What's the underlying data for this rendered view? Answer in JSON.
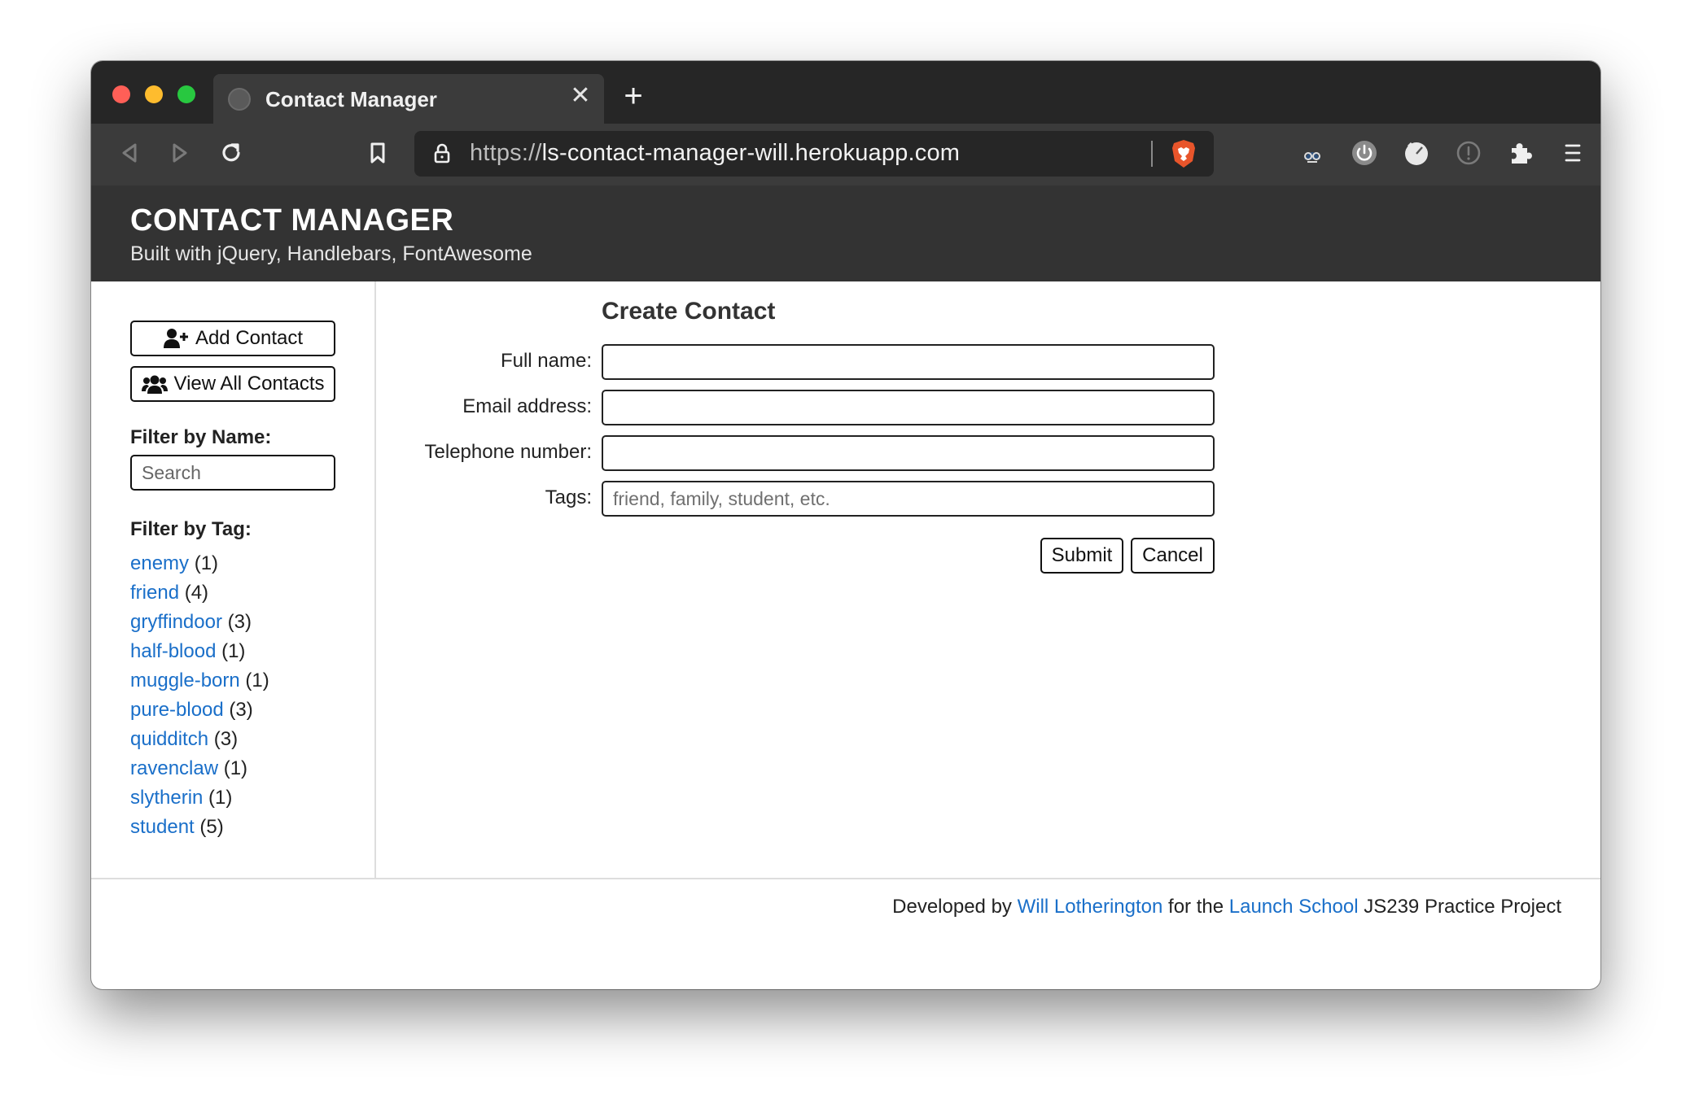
{
  "browser": {
    "tab_title": "Contact Manager",
    "url_scheme": "https://",
    "url_host": "ls-contact-manager-will.herokuapp.com"
  },
  "header": {
    "title": "CONTACT MANAGER",
    "subtitle": "Built with jQuery, Handlebars, FontAwesome"
  },
  "sidebar": {
    "add_contact_label": "Add Contact",
    "view_all_label": "View All Contacts",
    "filter_name_heading": "Filter by Name:",
    "search_placeholder": "Search",
    "filter_tag_heading": "Filter by Tag:",
    "tags": [
      {
        "name": "enemy",
        "count": "(1)"
      },
      {
        "name": "friend",
        "count": "(4)"
      },
      {
        "name": "gryffindoor",
        "count": "(3)"
      },
      {
        "name": "half-blood",
        "count": "(1)"
      },
      {
        "name": "muggle-born",
        "count": "(1)"
      },
      {
        "name": "pure-blood",
        "count": "(3)"
      },
      {
        "name": "quidditch",
        "count": "(3)"
      },
      {
        "name": "ravenclaw",
        "count": "(1)"
      },
      {
        "name": "slytherin",
        "count": "(1)"
      },
      {
        "name": "student",
        "count": "(5)"
      }
    ]
  },
  "form": {
    "title": "Create Contact",
    "full_name_label": "Full name:",
    "email_label": "Email address:",
    "phone_label": "Telephone number:",
    "tags_label": "Tags:",
    "tags_placeholder": "friend, family, student, etc.",
    "submit_label": "Submit",
    "cancel_label": "Cancel"
  },
  "footer": {
    "prefix": "Developed by",
    "author": "Will Lotherington",
    "middle": "for the",
    "school": "Launch School",
    "suffix": "JS239 Practice Project"
  },
  "colors": {
    "link": "#1a6fc9",
    "header_bg": "#333333",
    "tabstrip_bg": "#262626",
    "toolbar_bg": "#3b3b3b"
  }
}
